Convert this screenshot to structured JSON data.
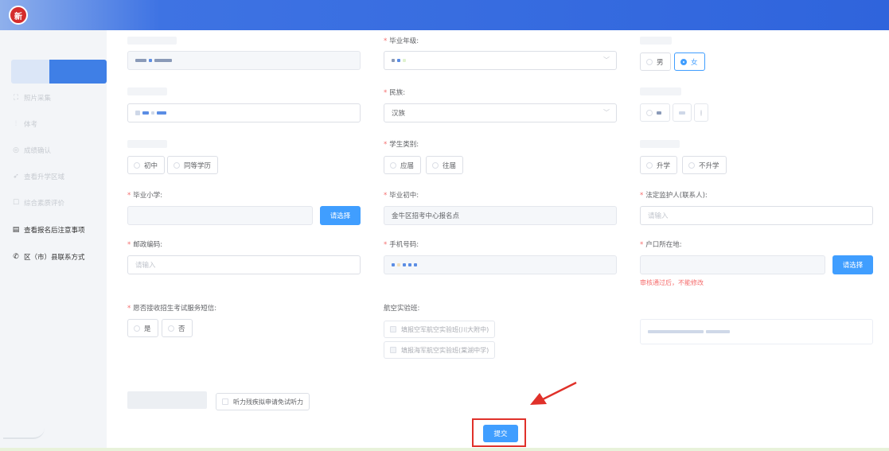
{
  "header": {
    "logo_text": "新"
  },
  "sidebar": {
    "items": [
      {
        "label": "照片采集",
        "icon": "frame-icon",
        "state": "faded"
      },
      {
        "label": "体考",
        "icon": "chart-icon",
        "state": "faded"
      },
      {
        "label": "成绩确认",
        "icon": "check-circle-icon",
        "state": "faded"
      },
      {
        "label": "查看升学区域",
        "icon": "send-icon",
        "state": "faded"
      },
      {
        "label": "综合素质评价",
        "icon": "square-icon",
        "state": "faded"
      },
      {
        "label": "查看报名后注意事项",
        "icon": "document-icon",
        "state": "normal"
      },
      {
        "label": "区（市）县联系方式",
        "icon": "phone-icon",
        "state": "normal"
      }
    ]
  },
  "form": {
    "grade_label": "毕业年级:",
    "ethnicity_label": "民族:",
    "ethnicity_value": "汉族",
    "student_type_label": "学生类别:",
    "student_type_options": [
      "应届",
      "往届"
    ],
    "gender_options": [
      "男",
      "女"
    ],
    "gender_selected": "女",
    "education_options": [
      "初中",
      "同等学历"
    ],
    "promotion_options": [
      "升学",
      "不升学"
    ],
    "primary_school_label": "毕业小学:",
    "primary_school_button": "请选择",
    "middle_school_label": "毕业初中:",
    "middle_school_value": "金牛区招考中心报名点",
    "guardian_label": "法定监护人(联系人):",
    "guardian_placeholder": "请输入",
    "postal_label": "邮政编码:",
    "postal_placeholder": "请输入",
    "phone_label": "手机号码:",
    "hukou_label": "户口所在地:",
    "hukou_button": "请选择",
    "hukou_warning": "审核通过后，不能修改",
    "sms_label": "愿否接收招生考试服务短信:",
    "sms_options": [
      "是",
      "否"
    ],
    "aviation_label": "航空实验班:",
    "aviation_options": [
      "填报空军航空实验班(川大附中)",
      "填报海军航空实验班(棠湖中学)"
    ],
    "hearing_option": "听力残疾拟申请免试听力",
    "submit_label": "提交"
  },
  "colors": {
    "primary": "#409eff",
    "required": "#f56c6c",
    "highlight": "#e0312a",
    "header": "#2f64dc"
  }
}
